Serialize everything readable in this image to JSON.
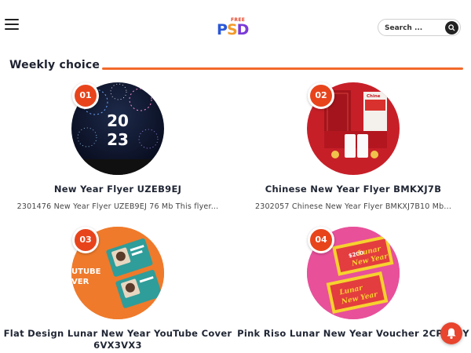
{
  "header": {
    "menu_icon": "hamburger-menu-icon",
    "logo": {
      "small_text": "FREE",
      "letters": [
        "P",
        "S",
        "D"
      ]
    },
    "search": {
      "placeholder": "Search ...",
      "button_icon": "search-icon"
    }
  },
  "section": {
    "title": "Weekly choice",
    "accent_color": "#f26a2b"
  },
  "cards": [
    {
      "number": "01",
      "title": "New Year Flyer UZEB9EJ",
      "description": "2301476 New Year Flyer UZEB9EJ 76 Mb This flyer...",
      "thumb_text": [
        "20",
        "23"
      ]
    },
    {
      "number": "02",
      "title": "Chinese New Year Flyer BMKXJ7B",
      "description": "2302057 Chinese New Year Flyer BMKXJ7B10 Mb...",
      "thumb_text": [
        "Chine"
      ]
    },
    {
      "number": "03",
      "title": "Flat Design Lunar New Year YouTube Cover 6VX3VX3",
      "description": "",
      "thumb_text": [
        "UTUBE",
        "VER"
      ]
    },
    {
      "number": "04",
      "title": "Pink Riso Lunar New Year Voucher 2CP4ECY",
      "description": "",
      "thumb_text": [
        "Lunar",
        "New Year",
        "$200"
      ]
    }
  ],
  "notification": {
    "icon": "bell-icon"
  },
  "colors": {
    "badge": "#e8441c",
    "accent": "#f26a2b"
  }
}
